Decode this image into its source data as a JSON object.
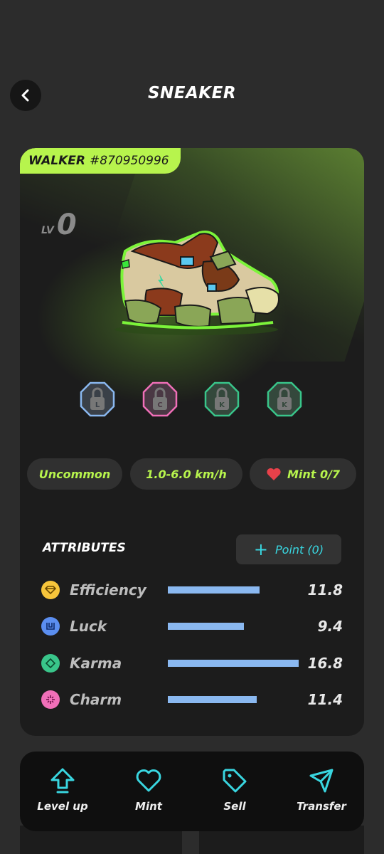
{
  "header": {
    "title": "SNEAKER"
  },
  "sneaker": {
    "type": "WALKER",
    "id": "#870950996",
    "level_label": "LV",
    "level": "0",
    "slots": [
      "L",
      "C",
      "K",
      "K"
    ],
    "rarity": "Uncommon",
    "speed": "1.0-6.0 km/h",
    "mint": "Mint 0/7"
  },
  "attributes": {
    "title": "ATTRIBUTES",
    "point_label": "Point (0)",
    "items": [
      {
        "name": "Efficiency",
        "value": "11.8",
        "fraction": 0.7,
        "color": "#f7c53b"
      },
      {
        "name": "Luck",
        "value": "9.4",
        "fraction": 0.58,
        "color": "#5b8ef0"
      },
      {
        "name": "Karma",
        "value": "16.8",
        "fraction": 1.0,
        "color": "#39c58a"
      },
      {
        "name": "Charm",
        "value": "11.4",
        "fraction": 0.68,
        "color": "#f06fb8"
      }
    ]
  },
  "nav": {
    "level_up": "Level up",
    "mint": "Mint",
    "sell": "Sell",
    "transfer": "Transfer"
  },
  "colors": {
    "accent": "#b7f44d",
    "cyan": "#39d6e0",
    "bar": "#8ab8f0"
  }
}
